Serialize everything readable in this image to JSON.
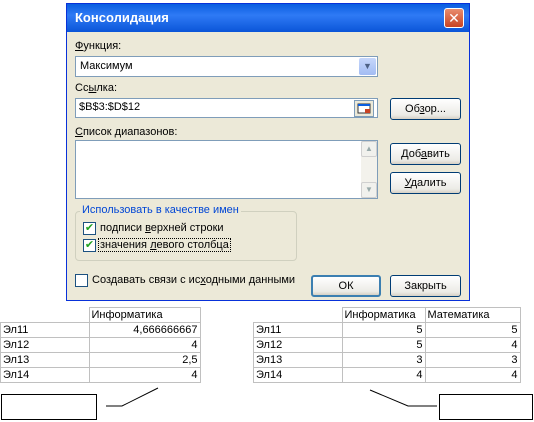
{
  "dialog": {
    "title": "Консолидация",
    "function_label_u": "Ф",
    "function_label_rest": "ункция:",
    "function_value": "Максимум",
    "ref_label_pre": "Сс",
    "ref_label_u": "ы",
    "ref_label_post": "лка:",
    "ref_value": "$B$3:$D$12",
    "browse_pre": "Об",
    "browse_u": "з",
    "browse_post": "ор...",
    "list_label_u": "С",
    "list_label_rest": "писок диапазонов:",
    "add_pre": "Доб",
    "add_u": "а",
    "add_post": "вить",
    "delete_u": "У",
    "delete_rest": "далить",
    "group_label": "Использовать в качестве имен",
    "top_row_pre": "подписи ",
    "top_row_u": "в",
    "top_row_post": "ерхней строки",
    "top_row_checked": true,
    "left_col_pre": "значения ",
    "left_col_u": "л",
    "left_col_post": "евого столбца",
    "left_col_checked": true,
    "links_pre": "Создавать связи с ис",
    "links_u": "х",
    "links_post": "одными данными",
    "links_checked": false,
    "ok_label": "ОК",
    "close_label": "Закрыть",
    "check_mark": "✔",
    "close_icon": "✕",
    "arrow_down": "▼"
  },
  "left_table": {
    "header": [
      "",
      "Информатика"
    ],
    "rows": [
      [
        "Эл11",
        "4,666666667"
      ],
      [
        "Эл12",
        "4"
      ],
      [
        "Эл13",
        "2,5"
      ],
      [
        "Эл14",
        "4"
      ]
    ]
  },
  "right_table": {
    "header": [
      "",
      "Информатика",
      "Математика"
    ],
    "rows": [
      [
        "Эл11",
        "5",
        "5"
      ],
      [
        "Эл12",
        "5",
        "4"
      ],
      [
        "Эл13",
        "3",
        "3"
      ],
      [
        "Эл14",
        "4",
        "4"
      ]
    ]
  },
  "colors": {
    "title_bar": "#0a5ee0",
    "close_button": "#c94323",
    "group_label": "#0046d5",
    "check": "#21a121"
  }
}
